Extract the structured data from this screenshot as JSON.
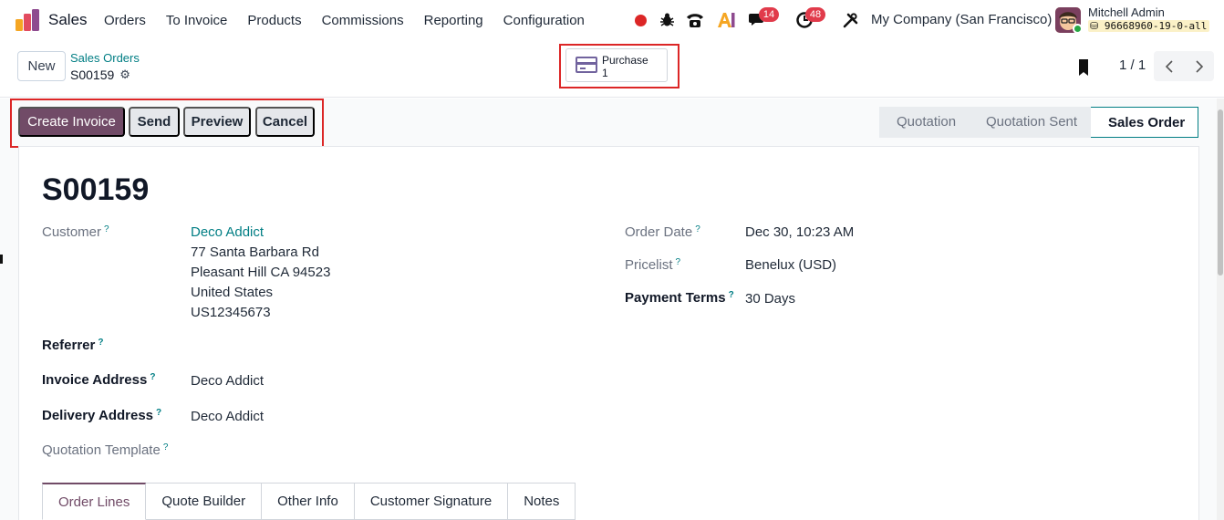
{
  "navbar": {
    "app_name": "Sales",
    "menu": [
      "Orders",
      "To Invoice",
      "Products",
      "Commissions",
      "Reporting",
      "Configuration"
    ],
    "chat_badge": "14",
    "activity_badge": "48",
    "company": "My Company (San Francisco)",
    "user_name": "Mitchell Admin",
    "db_name": "96668960-19-0-all",
    "record_dot_color": "#dc2626",
    "icons": [
      "record-dot-icon",
      "bug-icon",
      "phone-icon",
      "ai-icon",
      "chat-icon",
      "clock-icon",
      "tools-icon"
    ]
  },
  "control": {
    "new_label": "New",
    "breadcrumb": "Sales Orders",
    "record_name": "S00159",
    "smart_button": {
      "label": "Purchase",
      "value": "1"
    },
    "pager": "1 / 1"
  },
  "actions": {
    "create_invoice": "Create Invoice",
    "send": "Send",
    "preview": "Preview",
    "cancel": "Cancel"
  },
  "stages": [
    {
      "label": "Quotation",
      "active": false
    },
    {
      "label": "Quotation Sent",
      "active": false
    },
    {
      "label": "Sales Order",
      "active": true
    }
  ],
  "form": {
    "title": "S00159",
    "customer_label": "Customer",
    "customer_name": "Deco Addict",
    "address_line1": "77 Santa Barbara Rd",
    "address_line2": "Pleasant Hill CA 94523",
    "address_line3": "United States",
    "address_line4": "US12345673",
    "referrer_label": "Referrer",
    "invoice_address_label": "Invoice Address",
    "invoice_address": "Deco Addict",
    "delivery_address_label": "Delivery Address",
    "delivery_address": "Deco Addict",
    "quotation_template_label": "Quotation Template",
    "order_date_label": "Order Date",
    "order_date": "Dec 30, 10:23 AM",
    "pricelist_label": "Pricelist",
    "pricelist": "Benelux (USD)",
    "payment_terms_label": "Payment Terms",
    "payment_terms": "30 Days",
    "help_mark": "?"
  },
  "tabs": [
    "Order Lines",
    "Quote Builder",
    "Other Info",
    "Customer Signature",
    "Notes"
  ],
  "colors": {
    "primary": "#714b67",
    "link": "#017e84",
    "highlight_box": "#dc2626",
    "badge": "#e13b4b"
  }
}
